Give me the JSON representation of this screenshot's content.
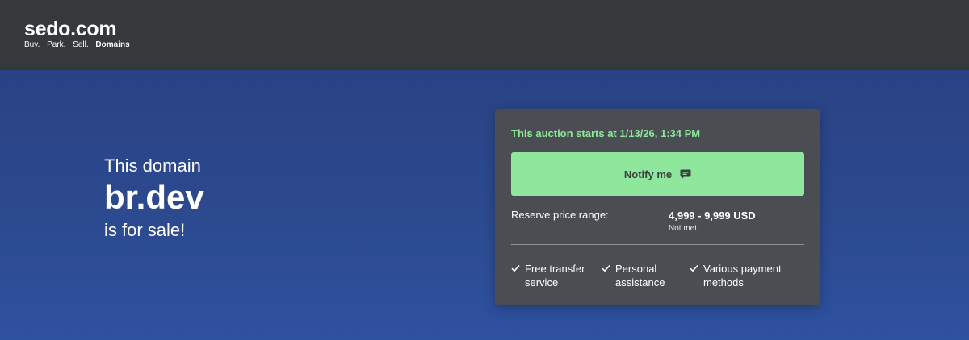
{
  "header": {
    "logo_text": "sedo.com",
    "tagline": [
      "Buy.",
      "Park.",
      "Sell."
    ],
    "tagline_strong": "Domains"
  },
  "headline": {
    "pre": "This domain",
    "domain": "br.dev",
    "post": "is for sale!"
  },
  "card": {
    "auction_note": "This auction starts at 1/13/26, 1:34 PM",
    "notify_label": "Notify me",
    "notify_icon": "chat-bubble-icon",
    "reserve_label": "Reserve price range:",
    "reserve_value": "4,999 - 9,999 USD",
    "reserve_status": "Not met.",
    "features": [
      {
        "line1": "Free transfer",
        "line2": "service"
      },
      {
        "line1": "Personal",
        "line2": "assistance"
      },
      {
        "line1": "Various payment",
        "line2": "methods"
      }
    ]
  },
  "colors": {
    "header_bg": "#35393c",
    "hero_bg": "#2a4488",
    "card_bg": "#4a4d51",
    "accent_green": "#8fe79d"
  }
}
